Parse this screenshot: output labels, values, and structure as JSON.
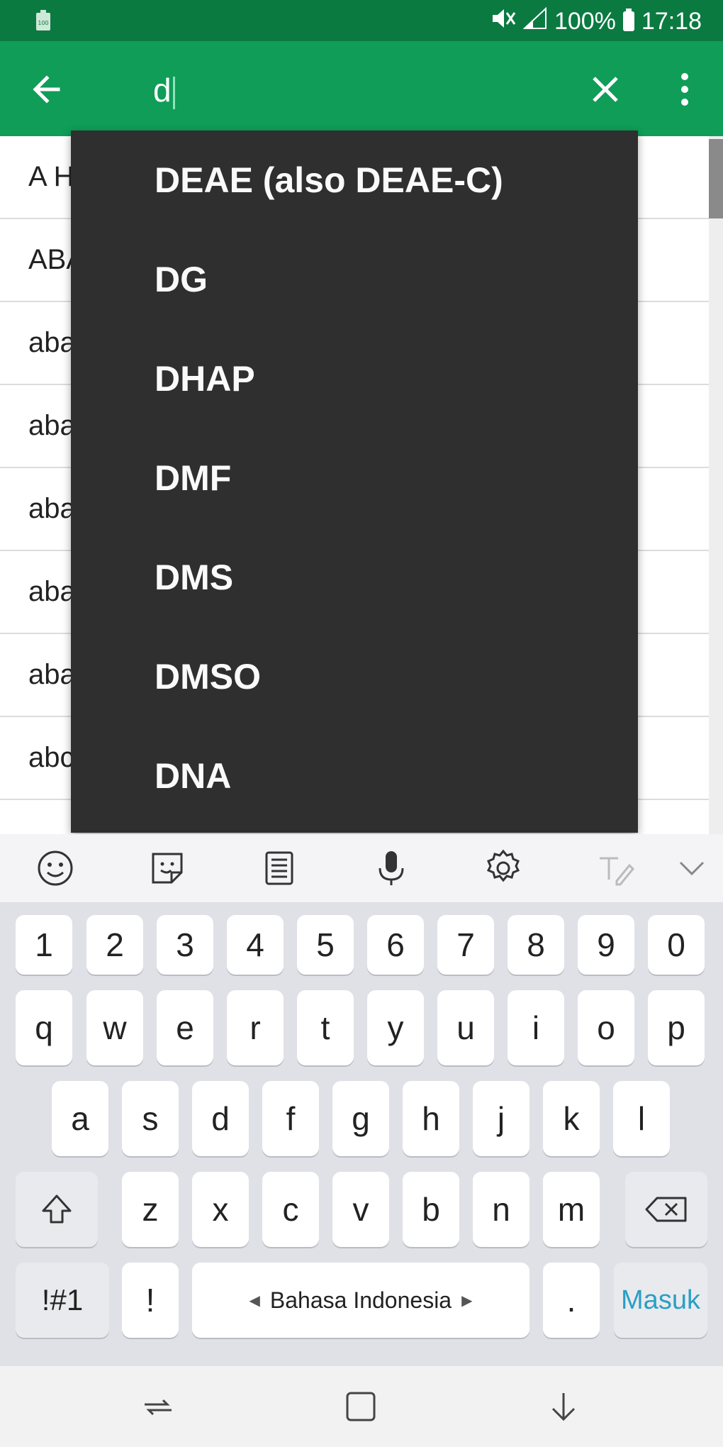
{
  "status_bar": {
    "battery_percent": "100%",
    "time": "17:18",
    "icons": [
      "battery-saver-icon",
      "mute-icon",
      "signal-icon",
      "battery-icon"
    ]
  },
  "app_bar": {
    "search_value": "d",
    "icons": [
      "back-arrow-icon",
      "clear-icon",
      "more-vert-icon"
    ]
  },
  "list": {
    "items": [
      "A H",
      "ABA",
      "aba",
      "aba",
      "aba",
      "aba",
      "aba",
      "abc"
    ]
  },
  "suggestions": [
    "DEAE (also DEAE-C)",
    "DG",
    "DHAP",
    "DMF",
    "DMS",
    "DMSO",
    "DNA"
  ],
  "keyboard": {
    "toolbar_icons": [
      "emoji-icon",
      "sticker-icon",
      "clipboard-icon",
      "microphone-icon",
      "settings-icon",
      "handwriting-icon",
      "chevron-down-icon"
    ],
    "number_row": [
      "1",
      "2",
      "3",
      "4",
      "5",
      "6",
      "7",
      "8",
      "9",
      "0"
    ],
    "row_q": [
      "q",
      "w",
      "e",
      "r",
      "t",
      "y",
      "u",
      "i",
      "o",
      "p"
    ],
    "row_a": [
      "a",
      "s",
      "d",
      "f",
      "g",
      "h",
      "j",
      "k",
      "l"
    ],
    "row_z": [
      "z",
      "x",
      "c",
      "v",
      "b",
      "n",
      "m"
    ],
    "symbols_label": "!#1",
    "exclaim_label": "!",
    "space_label": "Bahasa Indonesia",
    "period_label": ".",
    "enter_label": "Masuk",
    "enter_color": "#2a9fc4"
  },
  "nav_bar": {
    "icons": [
      "recents-icon",
      "home-icon",
      "back-down-icon"
    ]
  }
}
